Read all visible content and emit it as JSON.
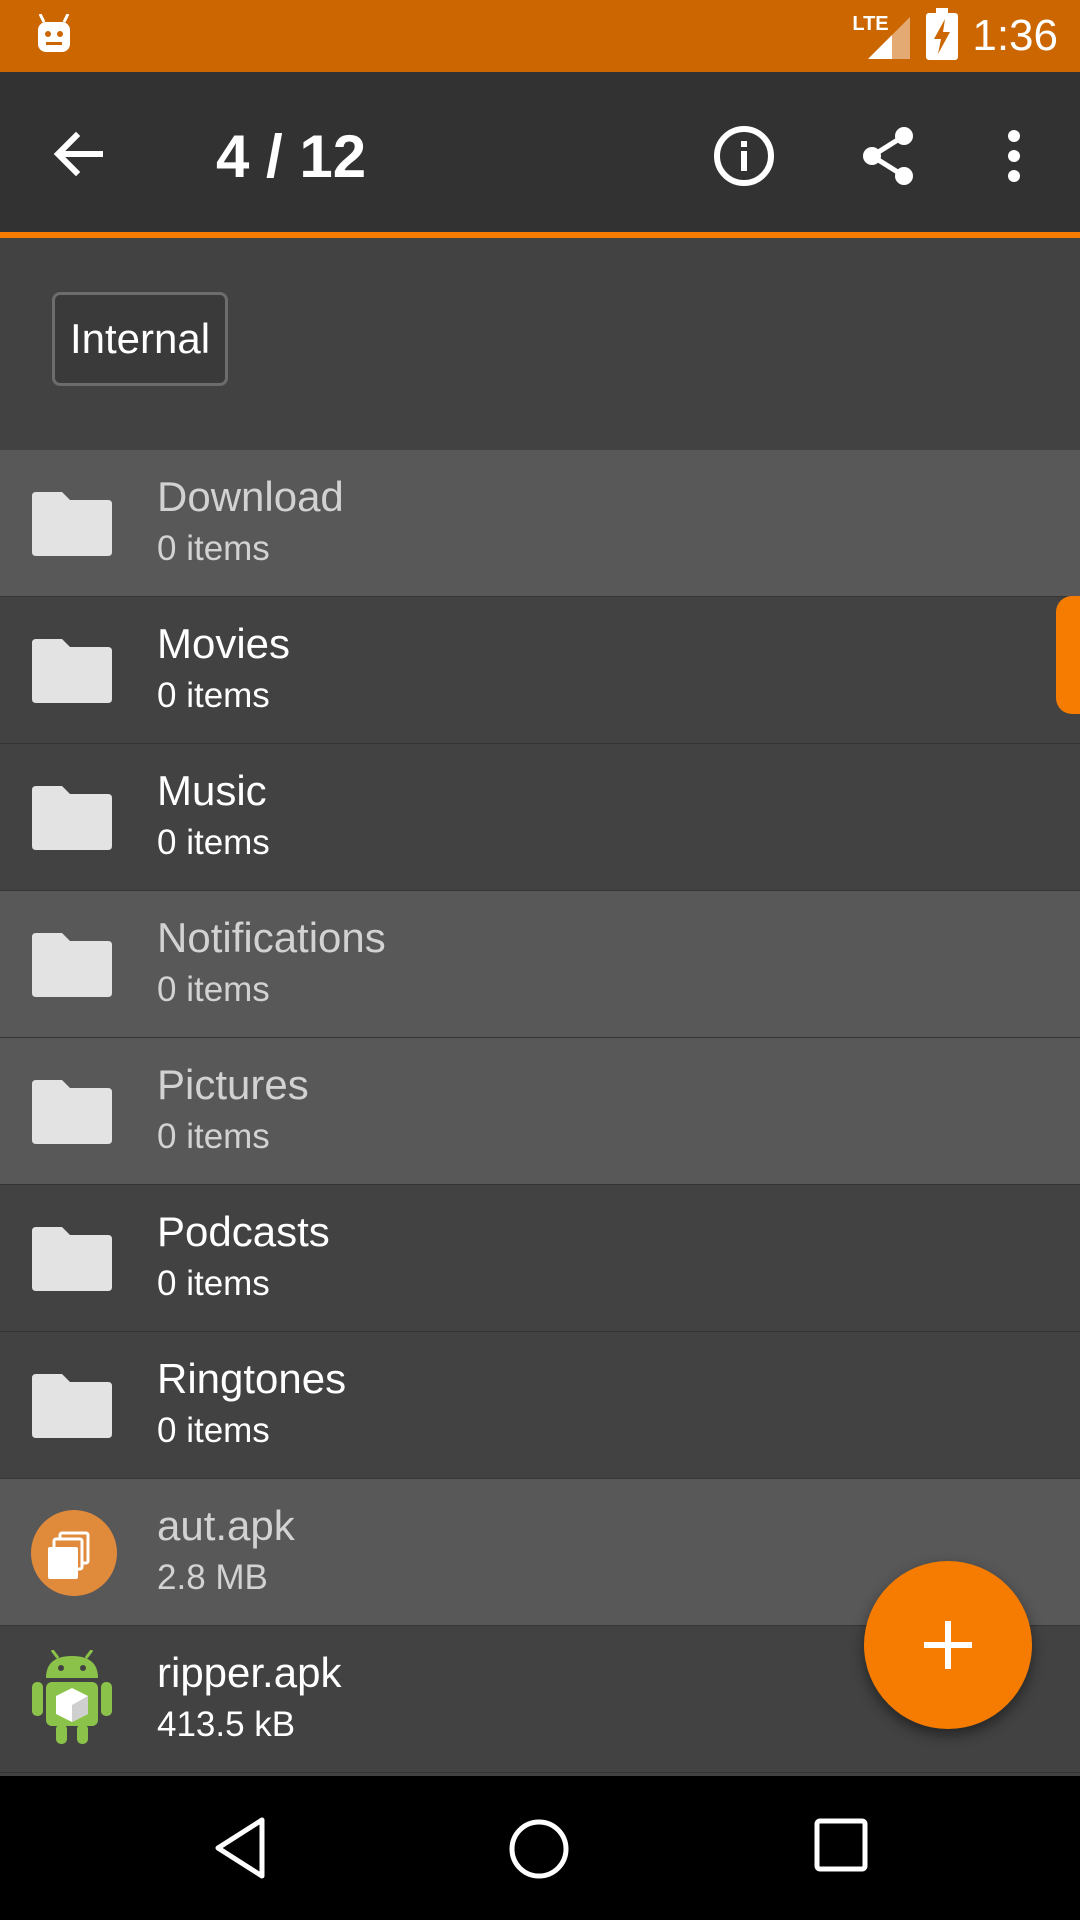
{
  "status_bar": {
    "time": "1:36",
    "network_label": "LTE",
    "app_icon": "android-robot-icon",
    "bg_color": "#CC6600"
  },
  "toolbar": {
    "title": "4 / 12",
    "back_icon": "arrow-back-icon",
    "info_icon": "info-icon",
    "share_icon": "share-icon",
    "more_icon": "more-vert-icon"
  },
  "breadcrumb": {
    "current": "Internal"
  },
  "files": [
    {
      "name": "Download",
      "detail": "0 items",
      "icon": "folder-icon"
    },
    {
      "name": "Movies",
      "detail": "0 items",
      "icon": "folder-icon"
    },
    {
      "name": "Music",
      "detail": "0 items",
      "icon": "folder-icon"
    },
    {
      "name": "Notifications",
      "detail": "0 items",
      "icon": "folder-icon"
    },
    {
      "name": "Pictures",
      "detail": "0 items",
      "icon": "folder-icon"
    },
    {
      "name": "Podcasts",
      "detail": "0 items",
      "icon": "folder-icon"
    },
    {
      "name": "Ringtones",
      "detail": "0 items",
      "icon": "folder-icon"
    },
    {
      "name": "aut.apk",
      "detail": "2.8 MB",
      "icon": "app-icon-orange"
    },
    {
      "name": "ripper.apk",
      "detail": "413.5 kB",
      "icon": "android-apk-icon"
    }
  ],
  "fab": {
    "icon": "plus-icon"
  },
  "colors": {
    "accent": "#F57C00",
    "toolbar": "#323232",
    "background": "#424242",
    "selected_row": "#585858"
  },
  "nav_bar": {
    "back_icon": "nav-back-icon",
    "home_icon": "nav-home-icon",
    "recents_icon": "nav-recents-icon"
  }
}
